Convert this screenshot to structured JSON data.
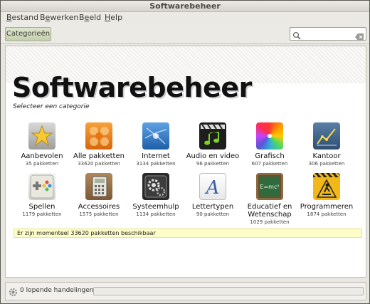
{
  "window": {
    "title": "Softwarebeheer"
  },
  "menubar": {
    "items": [
      {
        "label": "Bestand",
        "mnemonic": "B",
        "rest": "estand"
      },
      {
        "label": "Bewerken",
        "mnemonic": "e",
        "rest_pre": "B",
        "rest": "werken"
      },
      {
        "label": "Beeld",
        "mnemonic": "e",
        "rest_pre": "B",
        "rest": "eld"
      },
      {
        "label": "Help",
        "mnemonic": "H",
        "rest": "elp"
      }
    ]
  },
  "toolbar": {
    "categories_label": "Categorieën",
    "search_value": "",
    "search_placeholder": ""
  },
  "main": {
    "title": "Softwarebeheer",
    "subtitle": "Selecteer een categorie",
    "categories": [
      {
        "label": "Aanbevolen",
        "count": "35 pakketten",
        "icon": "star-icon"
      },
      {
        "label": "Alle pakketten",
        "count": "33620 pakketten",
        "icon": "packages-icon"
      },
      {
        "label": "Internet",
        "count": "3134 pakketten",
        "icon": "internet-icon"
      },
      {
        "label": "Audio en video",
        "count": "96 pakketten",
        "icon": "audio-video-icon"
      },
      {
        "label": "Grafisch",
        "count": "607 pakketten",
        "icon": "graphics-icon"
      },
      {
        "label": "Kantoor",
        "count": "306 pakketten",
        "icon": "office-icon"
      },
      {
        "label": "Spellen",
        "count": "1179 pakketten",
        "icon": "games-icon"
      },
      {
        "label": "Accessoires",
        "count": "1575 pakketten",
        "icon": "accessories-icon"
      },
      {
        "label": "Systeemhulp",
        "count": "1134 pakketten",
        "icon": "system-icon"
      },
      {
        "label": "Lettertypen",
        "count": "90 pakketten",
        "icon": "fonts-icon"
      },
      {
        "label": "Educatief en Wetenschap",
        "label_line1": "Educatief en",
        "label_line2": "Wetenschap",
        "count": "1029 pakketten",
        "icon": "education-icon"
      },
      {
        "label": "Programmeren",
        "count": "1874 pakketten",
        "icon": "programming-icon"
      }
    ],
    "status": "Er zijn momenteel 33620 pakketten beschikbaar"
  },
  "bottom": {
    "progress_text": "0 lopende handelingen",
    "progress": 0
  }
}
